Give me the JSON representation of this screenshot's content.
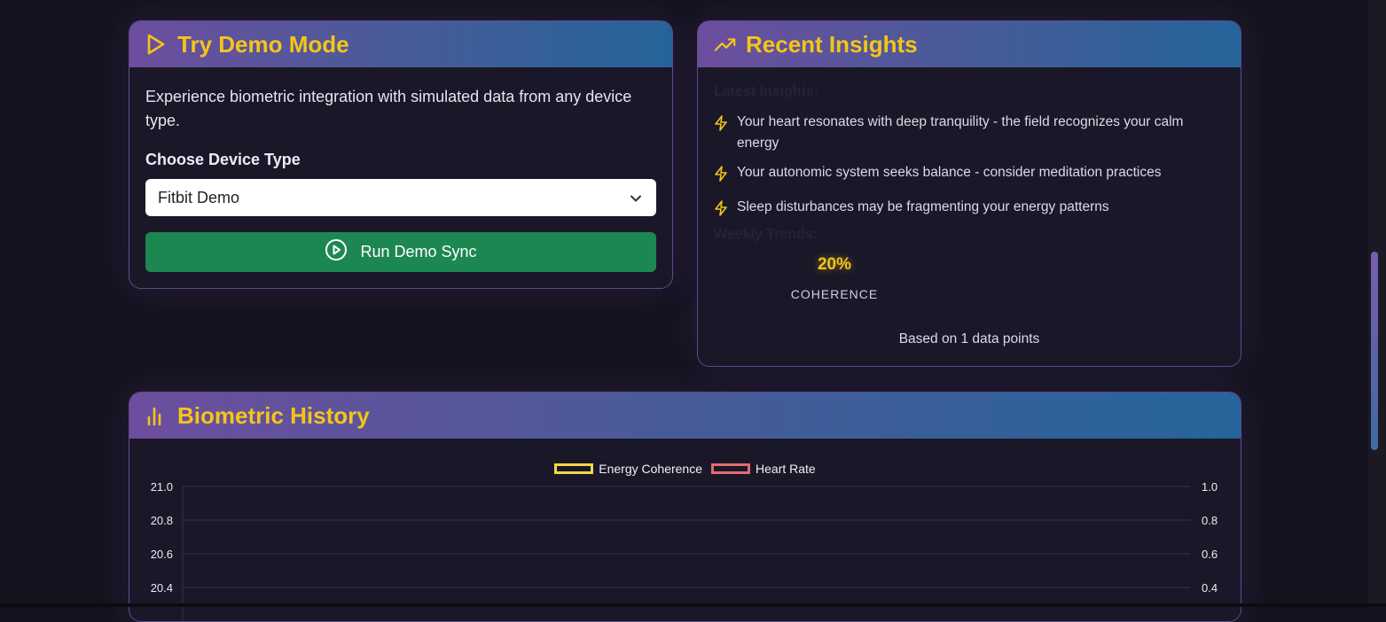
{
  "demo": {
    "title": "Try Demo Mode",
    "description": "Experience biometric integration with simulated data from any device type.",
    "device_label": "Choose Device Type",
    "device_selected": "Fitbit Demo",
    "run_button": "Run Demo Sync"
  },
  "insights": {
    "title": "Recent Insights",
    "latest_heading": "Latest Insights:",
    "items": [
      "Your heart resonates with deep tranquility - the field recognizes your calm energy",
      "Your autonomic system seeks balance - consider meditation practices",
      "Sleep disturbances may be fragmenting your energy patterns"
    ],
    "weekly_heading": "Weekly Trends:",
    "coherence_value": "20%",
    "coherence_label": "COHERENCE",
    "based_on": "Based on 1 data points"
  },
  "history": {
    "title": "Biometric History"
  },
  "colors": {
    "accent": "#f5c518",
    "header_gradient_start": "#6d4e9e",
    "header_gradient_end": "#25649a",
    "run_button": "#1d8752",
    "energy_coherence": "#f5d547",
    "heart_rate": "#e46a72"
  },
  "chart_data": {
    "type": "line",
    "series": [
      {
        "name": "Energy Coherence",
        "values": []
      },
      {
        "name": "Heart Rate",
        "values": []
      }
    ],
    "y_left_ticks": [
      "21.0",
      "20.8",
      "20.6",
      "20.4"
    ],
    "y_right_ticks": [
      "1.0",
      "0.8",
      "0.6",
      "0.4"
    ],
    "legend_position": "top-center",
    "grid": true
  }
}
